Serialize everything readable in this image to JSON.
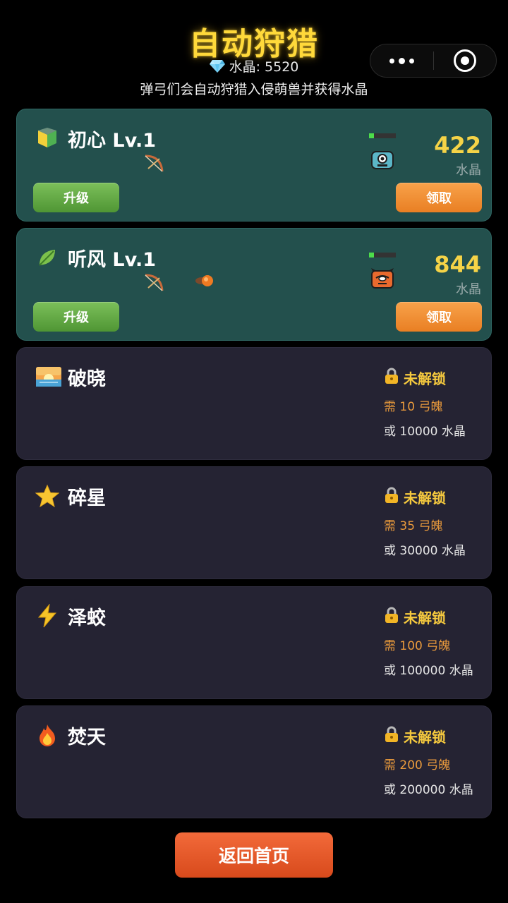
{
  "header": {
    "title": "自动狩猎",
    "crystal_label": "水晶: 5520",
    "subtitle": "弹弓们会自动狩猎入侵萌兽并获得水晶"
  },
  "capsule": {
    "menu_icon": "more-dots-icon",
    "close_icon": "target-circle-icon"
  },
  "colors": {
    "accent_gold": "#ffd93a",
    "active_card": "#23504d",
    "locked_card": "#252333",
    "upgrade_green": "#5aa53c",
    "claim_orange": "#f08f30",
    "back_button": "#e4562a"
  },
  "active_slots": [
    {
      "icon": "beginner-badge-icon",
      "name": "初心 Lv.1",
      "count": "422",
      "unit": "水晶",
      "upgrade_label": "升级",
      "claim_label": "领取"
    },
    {
      "icon": "leaf-icon",
      "name": "听风 Lv.1",
      "count": "844",
      "unit": "水晶",
      "upgrade_label": "升级",
      "claim_label": "领取"
    }
  ],
  "locked_slots": [
    {
      "icon": "sunrise-icon",
      "name": "破晓",
      "status": "未解锁",
      "requirement": "需 10 弓魄",
      "alternative": "或 10000 水晶"
    },
    {
      "icon": "star-icon",
      "name": "碎星",
      "status": "未解锁",
      "requirement": "需 35 弓魄",
      "alternative": "或 30000 水晶"
    },
    {
      "icon": "lightning-icon",
      "name": "泽蛟",
      "status": "未解锁",
      "requirement": "需 100 弓魄",
      "alternative": "或 100000 水晶"
    },
    {
      "icon": "fire-icon",
      "name": "焚天",
      "status": "未解锁",
      "requirement": "需 200 弓魄",
      "alternative": "或 200000 水晶"
    }
  ],
  "footer": {
    "back_label": "返回首页"
  }
}
